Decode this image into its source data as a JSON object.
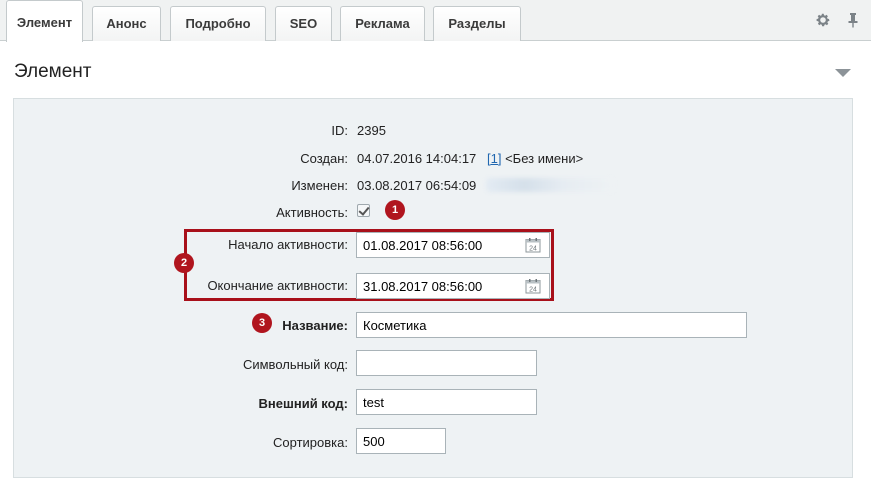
{
  "tabs": [
    {
      "label": "Элемент",
      "active": true
    },
    {
      "label": "Анонс",
      "active": false
    },
    {
      "label": "Подробно",
      "active": false
    },
    {
      "label": "SEO",
      "active": false
    },
    {
      "label": "Реклама",
      "active": false
    },
    {
      "label": "Разделы",
      "active": false
    }
  ],
  "tab_icons": [
    "gear-icon",
    "pin-icon"
  ],
  "section": {
    "title": "Элемент"
  },
  "fields": {
    "id": {
      "label": "ID:",
      "value": "2395"
    },
    "created": {
      "label": "Создан:",
      "value": "04.07.2016 14:04:17",
      "user_link": "[1]",
      "user_name": "<Без имени>"
    },
    "modified": {
      "label": "Изменен:",
      "value": "03.08.2017 06:54:09"
    },
    "active": {
      "label": "Активность:",
      "checked": true
    },
    "active_from": {
      "label": "Начало активности:",
      "value": "01.08.2017 08:56:00"
    },
    "active_to": {
      "label": "Окончание активности:",
      "value": "31.08.2017 08:56:00"
    },
    "name": {
      "label": "Название:",
      "value": "Косметика"
    },
    "code": {
      "label": "Символьный код:",
      "value": ""
    },
    "xml_id": {
      "label": "Внешний код:",
      "value": "test"
    },
    "sort": {
      "label": "Сортировка:",
      "value": "500"
    }
  },
  "badges": {
    "one": "1",
    "two": "2",
    "three": "3"
  },
  "calendar_day": "24",
  "colors": {
    "accent": "#a8101a",
    "panel": "#eef2f4",
    "link": "#2067b0"
  }
}
